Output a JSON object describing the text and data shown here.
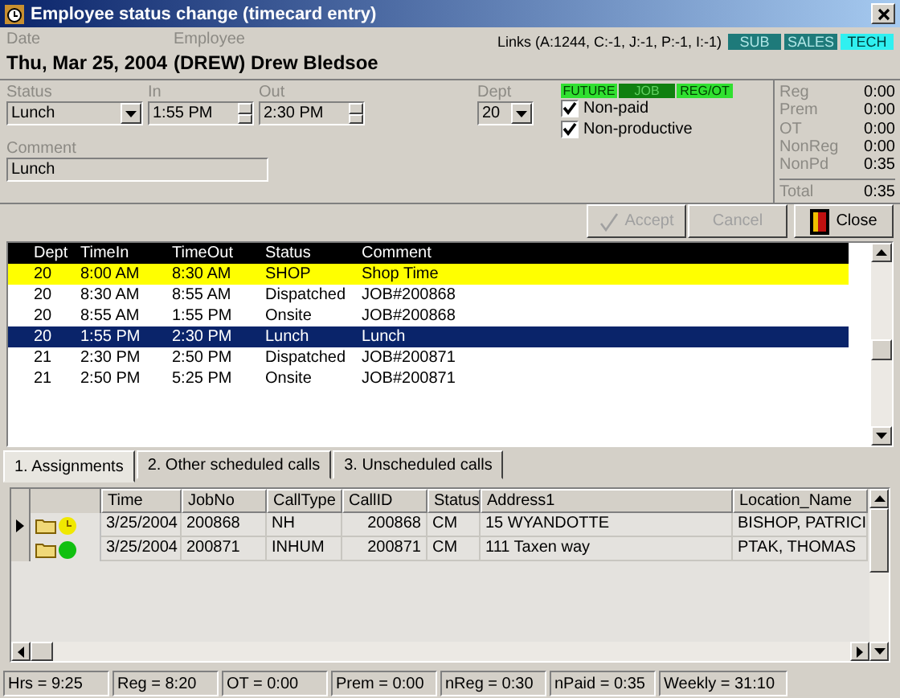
{
  "window": {
    "title": "Employee status change (timecard entry)"
  },
  "header": {
    "date_label": "Date",
    "date": "Thu, Mar 25, 2004",
    "employee_label": "Employee",
    "employee": "(DREW) Drew Bledsoe",
    "links": "Links (A:1244, C:-1, J:-1, P:-1, I:-1)",
    "badges": [
      {
        "label": "SUB",
        "on": false
      },
      {
        "label": "SALES",
        "on": false
      },
      {
        "label": "TECH",
        "on": true
      }
    ]
  },
  "form": {
    "status_label": "Status",
    "status": "Lunch",
    "in_label": "In",
    "in": "1:55 PM",
    "out_label": "Out",
    "out": "2:30 PM",
    "dept_label": "Dept",
    "dept": "20",
    "comment_label": "Comment",
    "comment": "Lunch",
    "flags": [
      {
        "label": "FUTURE",
        "on": false
      },
      {
        "label": "JOB",
        "on": true
      },
      {
        "label": "REG/OT",
        "on": false
      }
    ],
    "checks": [
      {
        "label": "Non-paid",
        "checked": true
      },
      {
        "label": "Non-productive",
        "checked": true
      }
    ]
  },
  "totals": [
    {
      "label": "Reg",
      "value": "0:00"
    },
    {
      "label": "Prem",
      "value": "0:00"
    },
    {
      "label": "OT",
      "value": "0:00"
    },
    {
      "label": "NonReg",
      "value": "0:00"
    },
    {
      "label": "NonPd",
      "value": "0:35"
    }
  ],
  "total": {
    "label": "Total",
    "value": "0:35"
  },
  "buttons": [
    {
      "label": "Accept",
      "disabled": true
    },
    {
      "label": "Cancel",
      "disabled": true
    },
    {
      "label": "Close",
      "disabled": false
    }
  ],
  "timecard": {
    "columns": [
      "Dept",
      "TimeIn",
      "TimeOut",
      "Status",
      "Comment"
    ],
    "rows": [
      {
        "cells": [
          "20",
          "8:00 AM",
          "8:30 AM",
          "SHOP",
          "Shop Time"
        ],
        "highlighted": true,
        "selected": false
      },
      {
        "cells": [
          "20",
          "8:30 AM",
          "8:55 AM",
          "Dispatched",
          "JOB#200868"
        ],
        "highlighted": false,
        "selected": false
      },
      {
        "cells": [
          "20",
          "8:55 AM",
          "1:55 PM",
          "Onsite",
          "JOB#200868"
        ],
        "highlighted": false,
        "selected": false
      },
      {
        "cells": [
          "20",
          "1:55 PM",
          "2:30 PM",
          "Lunch",
          "Lunch"
        ],
        "highlighted": false,
        "selected": true
      },
      {
        "cells": [
          "21",
          "2:30 PM",
          "2:50 PM",
          "Dispatched",
          "JOB#200871"
        ],
        "highlighted": false,
        "selected": false
      },
      {
        "cells": [
          "21",
          "2:50 PM",
          "5:25 PM",
          "Onsite",
          "JOB#200871"
        ],
        "highlighted": false,
        "selected": false
      }
    ]
  },
  "tabs": [
    {
      "label": "1. Assignments",
      "selected": true
    },
    {
      "label": "2. Other scheduled calls",
      "selected": false
    },
    {
      "label": "3. Unscheduled calls",
      "selected": false
    }
  ],
  "assignments": {
    "columns": [
      "Time",
      "JobNo",
      "CallType",
      "CallID",
      "Status",
      "Address1",
      "Location_Name"
    ],
    "rows": [
      {
        "cells": [
          "3/25/2004",
          "200868",
          "NH",
          "200868",
          "CM",
          "15 WYANDOTTE",
          "BISHOP, PATRICI"
        ],
        "selected": true,
        "kind": "clock",
        "color": "#f0e800"
      },
      {
        "cells": [
          "3/25/2004",
          "200871",
          "INHUM",
          "200871",
          "CM",
          "111 Taxen way",
          "PTAK, THOMAS"
        ],
        "selected": false,
        "kind": "dot",
        "color": "#10c010"
      }
    ]
  },
  "status_bar": [
    "Hrs = 9:25",
    "Reg = 8:20",
    "OT = 0:00",
    "Prem = 0:00",
    "nReg = 0:30",
    "nPaid = 0:35",
    "Weekly = 31:10"
  ]
}
